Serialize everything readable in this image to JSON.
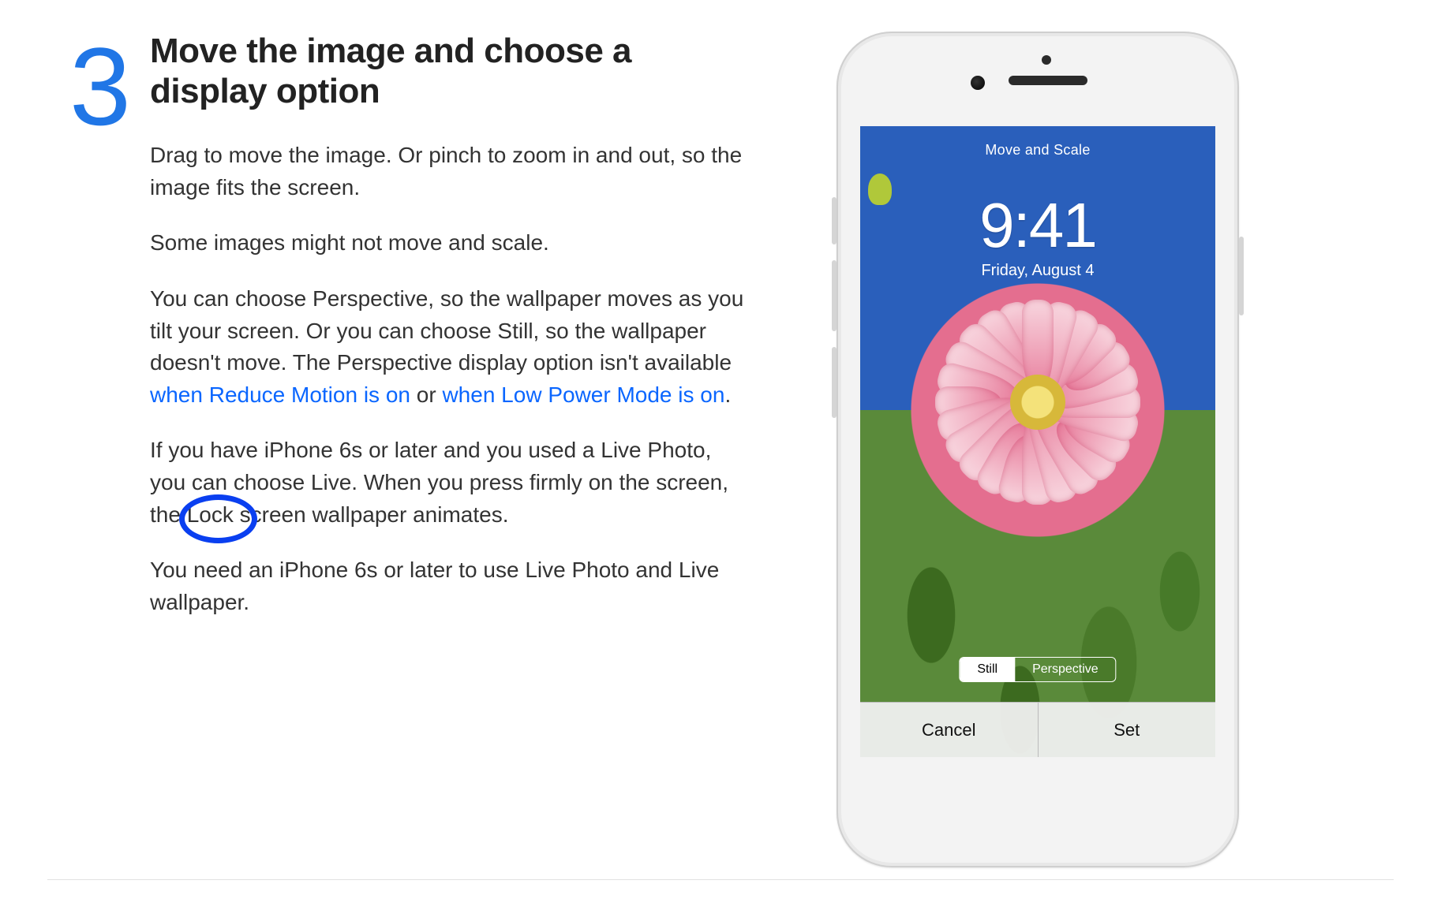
{
  "step_number": "3",
  "heading": "Move the image and choose a display option",
  "p1": "Drag to move the image. Or pinch to zoom in and out, so the image fits the screen.",
  "p2": "Some images might not move and scale.",
  "p3a": "You can choose Perspective, so the wallpaper moves as you tilt your screen. Or you can choose Still, so the wallpaper doesn't move. The Perspective display option isn't available ",
  "link1": "when Reduce Motion is on",
  "p3b": " or ",
  "link2": "when Low Power Mode is on",
  "p3c": ".",
  "p4a": "If you have iPhone 6s or later and you used a Live Photo, you can choose Live. When you press firmly on the screen, the ",
  "p4circled": "Lock",
  "p4b": " screen wallpaper animates.",
  "p5": "You need an iPhone 6s or later to use Live Photo and Live wallpaper.",
  "phone": {
    "top_label": "Move and Scale",
    "time": "9:41",
    "date": "Friday, August 4",
    "seg_still": "Still",
    "seg_perspective": "Perspective",
    "cancel": "Cancel",
    "set": "Set"
  }
}
